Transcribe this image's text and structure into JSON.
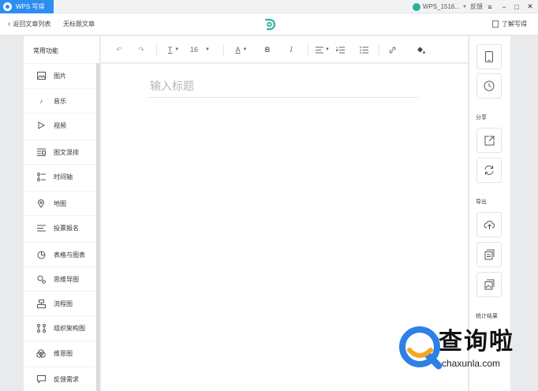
{
  "titlebar": {
    "app_name": "WPS 写得",
    "user_name": "WPS_1516...",
    "feedback": "反馈",
    "controls": [
      "≡",
      "−",
      "□",
      "✕"
    ]
  },
  "nav": {
    "back_label": "返回文章列表",
    "doc_title": "无标题文章",
    "help_label": "了解写得"
  },
  "sidebar": {
    "header": "常用功能",
    "items": [
      {
        "label": "图片",
        "icon": "image-icon"
      },
      {
        "label": "音乐",
        "icon": "music-icon"
      },
      {
        "label": "视频",
        "icon": "play-icon"
      },
      {
        "label": "图文混排",
        "icon": "layout-icon"
      },
      {
        "label": "时间轴",
        "icon": "timeline-icon"
      },
      {
        "label": "地图",
        "icon": "map-pin-icon"
      },
      {
        "label": "投票报名",
        "icon": "list-icon"
      },
      {
        "label": "表格与图表",
        "icon": "pie-chart-icon"
      },
      {
        "label": "思维导图",
        "icon": "mindmap-icon"
      },
      {
        "label": "流程图",
        "icon": "flowchart-icon"
      },
      {
        "label": "组织架构图",
        "icon": "org-chart-icon"
      },
      {
        "label": "维恩图",
        "icon": "venn-icon"
      },
      {
        "label": "反馈需求",
        "icon": "comment-icon"
      }
    ]
  },
  "toolbar": {
    "font_size": "16"
  },
  "editor": {
    "title_placeholder": "输入标题"
  },
  "rightpanel": {
    "share_label": "分享",
    "export_label": "导出",
    "stats_label": "统计结果"
  },
  "watermark": {
    "cn": "查询啦",
    "en": "chaxunla.com"
  },
  "colors": {
    "brand_blue": "#2c8ef0",
    "watermark_blue": "#2e7fe6",
    "watermark_orange": "#f5a623"
  }
}
